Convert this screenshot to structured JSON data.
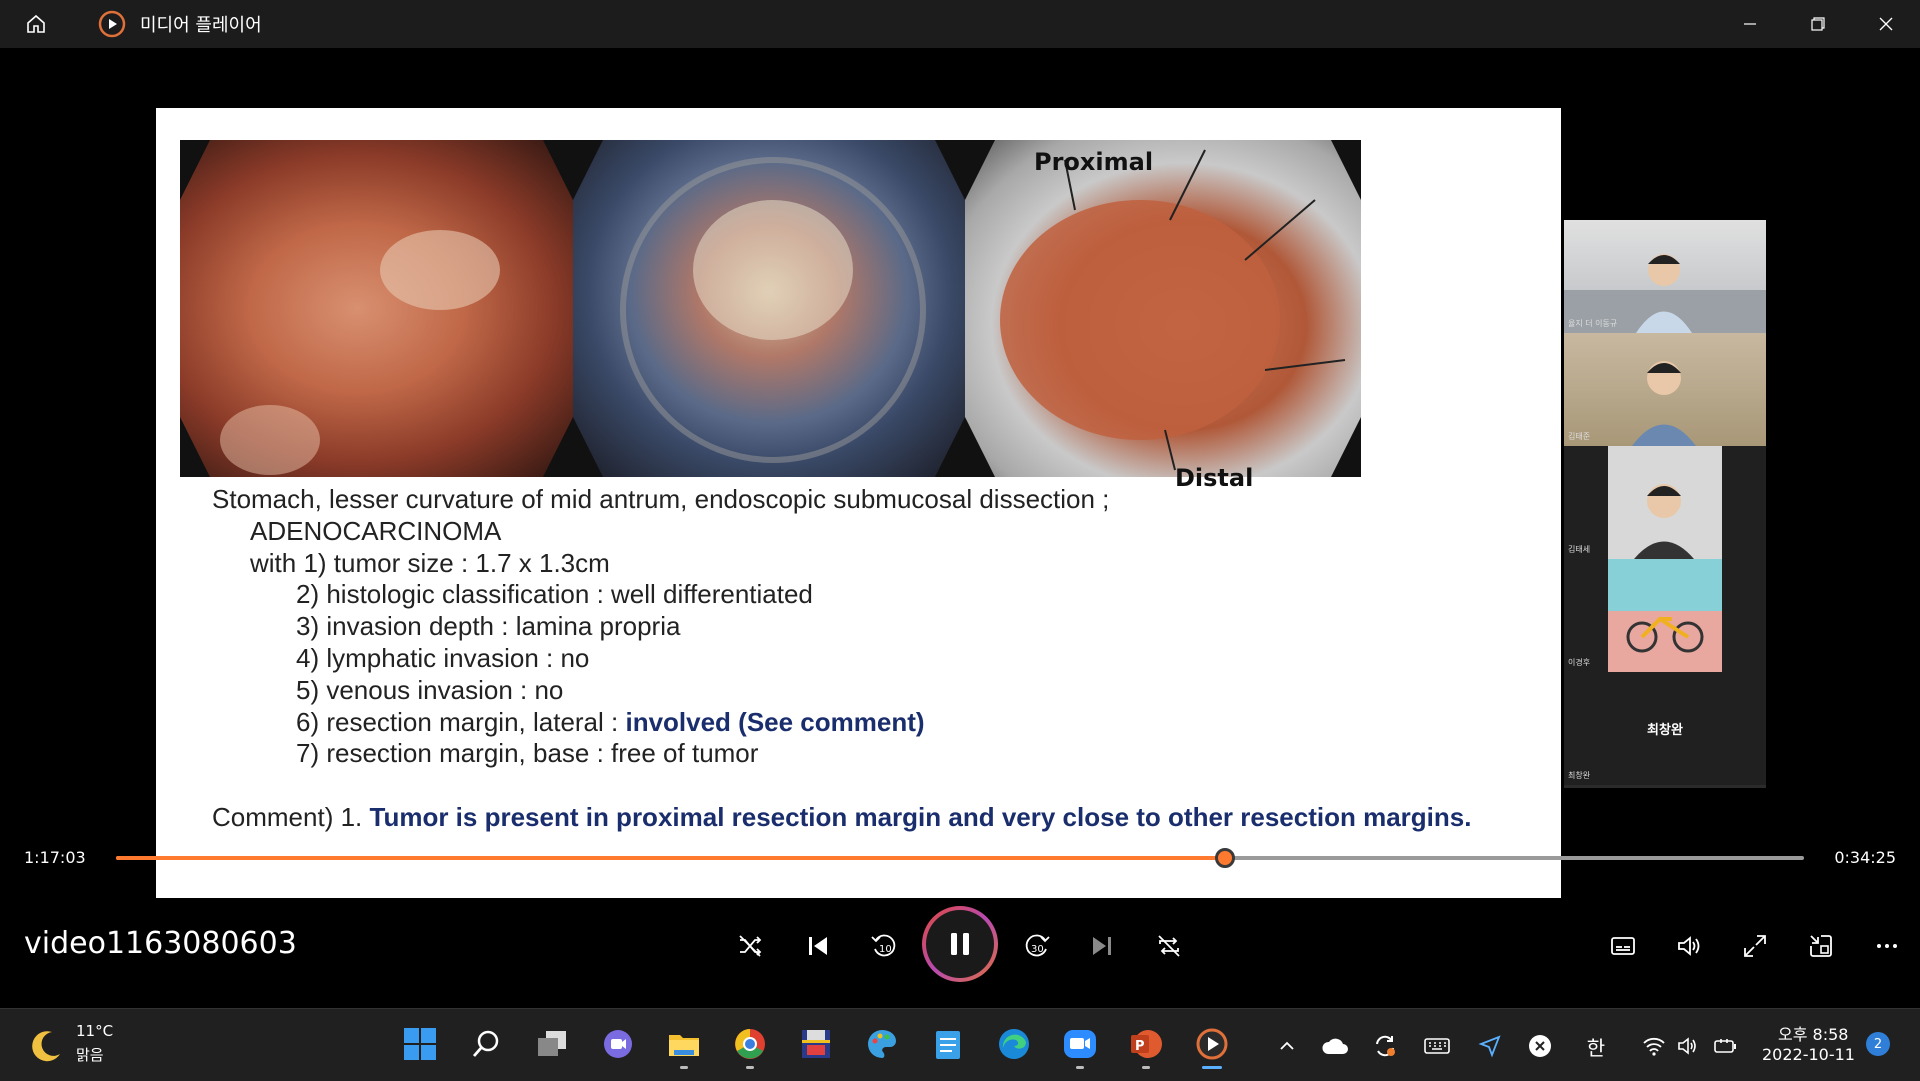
{
  "window": {
    "title": "미디어 플레이어"
  },
  "slide": {
    "label_proximal": "Proximal",
    "label_distal": "Distal",
    "lines": [
      "Stomach, lesser curvature of mid antrum, endoscopic submucosal dissection ;",
      "ADENOCARCINOMA",
      "with 1) tumor size : 1.7 x 1.3cm",
      "2) histologic classification : well differentiated",
      "3) invasion depth : lamina propria",
      "4) lymphatic invasion : no",
      "5) venous invasion : no",
      "6) resection margin, lateral : ",
      "involved (See comment)",
      "7) resection margin, base : free of tumor",
      "Comment) 1. ",
      "Tumor is present in proximal resection margin and very close to other resection margins."
    ]
  },
  "participants": [
    {
      "name": "율지 더 이동규"
    },
    {
      "name": "김태준"
    },
    {
      "name": "김태세"
    },
    {
      "name": "이경후"
    },
    {
      "name": "최창완",
      "center_label": "최창완"
    }
  ],
  "player": {
    "elapsed": "1:17:03",
    "remaining": "0:34:25",
    "progress": 0.657,
    "video_name": "video1163080603",
    "accent_color": "#ff7a2e"
  },
  "taskbar": {
    "weather_temp": "11°C",
    "weather_desc": "맑음",
    "ime": "한",
    "time": "오후 8:58",
    "date": "2022-10-11",
    "notifications": "2"
  }
}
